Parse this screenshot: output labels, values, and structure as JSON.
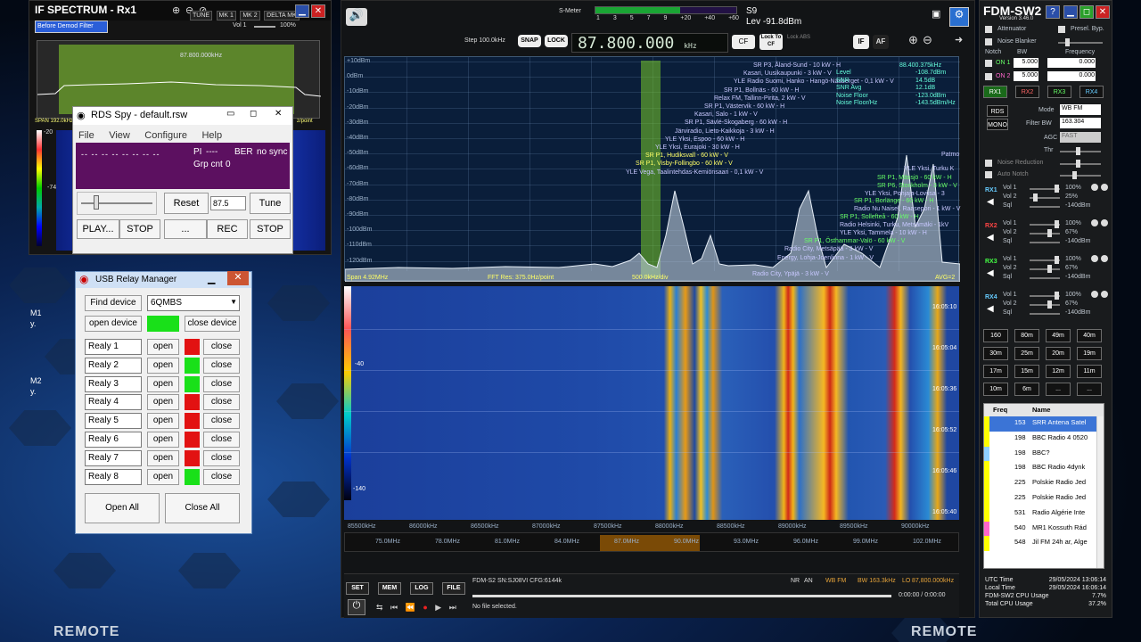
{
  "if_spectrum": {
    "title": "IF SPECTRUM - Rx1",
    "mode_select": "Before Demod Filter",
    "buttons": [
      "TUNE",
      "MK 1",
      "MK 2",
      "DELTA MK"
    ],
    "vol_label": "Vol 1",
    "vol_value": "100%",
    "axis": [
      "-100kHz",
      "-80kHz",
      "-60kHz",
      "-40kHz",
      "-20kHz",
      "0",
      "+20kHz",
      "+40kHz",
      "+60kHz",
      "+80kHz",
      "+100kHz"
    ],
    "freq_marker": "87.800.000kHz",
    "span": "SPAN 192.0kHz",
    "colorbar_top": "-20",
    "colorbar_low": "-74",
    "per_point": "z/point"
  },
  "rds_spy": {
    "title": "RDS Spy - default.rsw",
    "menu": [
      "File",
      "View",
      "Configure",
      "Help"
    ],
    "ps": "-- -- -- -- -- -- -- --",
    "pi_label": "PI",
    "pi_value": "----",
    "ber_label": "BER",
    "ber_value": "no sync",
    "grp_label": "Grp cnt",
    "grp_value": "0",
    "reset": "Reset",
    "freq": "87.5",
    "tune": "Tune",
    "play": "PLAY...",
    "stop1": "STOP",
    "dots": "...",
    "rec": "REC",
    "stop2": "STOP"
  },
  "usb_relay": {
    "title": "USB Relay Manager",
    "find_device": "Find device",
    "device": "6QMBS",
    "open_device": "open device",
    "close_device": "close device",
    "open": "open",
    "close": "close",
    "relays": [
      {
        "name": "Realy 1",
        "state": "red"
      },
      {
        "name": "Realy 2",
        "state": "green"
      },
      {
        "name": "Realy 3",
        "state": "green"
      },
      {
        "name": "Realy 4",
        "state": "red"
      },
      {
        "name": "Realy 5",
        "state": "red"
      },
      {
        "name": "Realy 6",
        "state": "red"
      },
      {
        "name": "Realy 7",
        "state": "red"
      },
      {
        "name": "Realy 8",
        "state": "green"
      }
    ],
    "open_all": "Open All",
    "close_all": "Close All"
  },
  "main": {
    "smeter_label": "S-Meter",
    "smeter_scale": [
      "1",
      "3",
      "5",
      "7",
      "9",
      "+20",
      "+40",
      "+60"
    ],
    "s_value": "S9",
    "level": "Lev -91.8dBm",
    "step": "Step 100.0kHz",
    "snap": "SNAP",
    "lock": "LOCK",
    "frequency": "87.800.000",
    "freq_unit": "kHz",
    "cf": "CF",
    "lock_to_cf": "Lock To CF",
    "lock_abs": "Lock ABS",
    "if_btn": "IF",
    "af_btn": "AF",
    "spec_db": [
      "+10dBm",
      "0dBm",
      "-10dBm",
      "-20dBm",
      "-30dBm",
      "-40dBm",
      "-50dBm",
      "-60dBm",
      "-70dBm",
      "-80dBm",
      "-90dBm",
      "-100dBm",
      "-110dBm",
      "-120dBm"
    ],
    "span": "Span 4.92MHz",
    "fft_res": "FFT Res: 375.0Hz/point",
    "div": "500.0kHz/div",
    "avg": "AVG=2",
    "wf_level_top": "-40",
    "wf_level_bottom": "-140",
    "freq_axis": [
      "85500kHz",
      "86000kHz",
      "86500kHz",
      "87000kHz",
      "87500kHz",
      "88000kHz",
      "88500kHz",
      "89000kHz",
      "89500kHz",
      "90000kHz"
    ],
    "band_axis": [
      "75.0MHz",
      "78.0MHz",
      "81.0MHz",
      "84.0MHz",
      "87.0MHz",
      "90.0MHz",
      "93.0MHz",
      "96.0MHz",
      "99.0MHz",
      "102.0MHz"
    ],
    "wf_times": [
      "16:05:10",
      "16:05:04",
      "16:05:36",
      "16:05:52",
      "16:05:46",
      "16:05:40"
    ],
    "stations": [
      {
        "t": "SR P3, Åland-Sund - 10 kW - H",
        "c": "#c8c8ff"
      },
      {
        "t": "Kasari, Uusikaupunki - 3 kW - V",
        "c": "#c8c8ff"
      },
      {
        "t": "YLE Radio Suomi, Hanko - Hangö-Näsberget - 0,1 kW - V",
        "c": "#c8c8ff"
      },
      {
        "t": "SR P1, Bollnäs - 60 kW - H",
        "c": "#c8c8ff"
      },
      {
        "t": "Relax FM, Tallinn-Pirita, 2 kW - V",
        "c": "#c8c8ff"
      },
      {
        "t": "SR P1, Västervik - 60 kW - H",
        "c": "#c8c8ff"
      },
      {
        "t": "Kasari, Salo - 1 kW - V",
        "c": "#c8c8ff"
      },
      {
        "t": "SR P1, Sävlé-Skogaberg - 60 kW - H",
        "c": "#c8c8ff"
      },
      {
        "t": "Järviradio, Lieto-Kaikkoja - 3 kW - H",
        "c": "#c8c8ff"
      },
      {
        "t": "YLE Yksi, Espoo - 60 kW - H",
        "c": "#c8c8ff"
      },
      {
        "t": "YLE Yksi, Eurajoki - 30 kW - H",
        "c": "#c8c8ff"
      },
      {
        "t": "SR P1, Hudiksvall - 60 kW - V",
        "c": "#ffff66"
      },
      {
        "t": "SR P1, Visby-Follingbo - 60 kW - V",
        "c": "#ffff66"
      },
      {
        "t": "YLE Vega, Taalintehdas-Kemiönsaari - 0,1 kW - V",
        "c": "#c8c8ff"
      }
    ],
    "stations_right": [
      {
        "t": "SR P1, Mässjö - 60 kW - H",
        "c": "#66ff66"
      },
      {
        "t": "SR P6, Stockholm - 3 kW - V",
        "c": "#66ff66"
      },
      {
        "t": "YLE Yksi, Pohjaja-Loviisa - 3",
        "c": "#c8c8ff"
      },
      {
        "t": "SR P1, Borlänge - 60 kW - H",
        "c": "#66ff66"
      },
      {
        "t": "Radio Nu Naisel, Raasepori - 1 kW - V",
        "c": "#c8c8ff"
      },
      {
        "t": "SR P1, Sollefteå - 60 kW - H",
        "c": "#66ff66"
      },
      {
        "t": "Radio Helsinki, Turku, Metsämäki - 1kV",
        "c": "#c8c8ff"
      },
      {
        "t": "YLE Yksi, Tammela - 10 kW - H",
        "c": "#c8c8ff"
      },
      {
        "t": "SR P1, Östhammar-Valö - 60 kW - V",
        "c": "#66ff66"
      },
      {
        "t": "Radio City, Metsäpää - 3 kW - V",
        "c": "#c8c8ff"
      },
      {
        "t": "Energy, Lohja-Joenlinna - 1 kW - V",
        "c": "#c8c8ff"
      },
      {
        "t": "Radio City, Ypäjä - 3 kW - V",
        "c": "#c8c8ff"
      },
      {
        "t": "YLE Yksi, Turku K",
        "c": "#c8c8ff"
      },
      {
        "t": "Patmo",
        "c": "#c8c8ff"
      }
    ],
    "readout": [
      {
        "k": "Level",
        "v": "-108.7dBm"
      },
      {
        "k": "SNR",
        "v": "14.5dB"
      },
      {
        "k": "SNR Avg",
        "v": "12.1dB"
      },
      {
        "k": "Noise Floor",
        "v": "-123.0dBm"
      },
      {
        "k": "Noise Floor/Hz",
        "v": "-143.5dBm/Hz"
      }
    ],
    "readout_freq": "88.400.375kHz",
    "set": "SET",
    "mem": "MEM",
    "log": "LOG",
    "file": "FILE",
    "device_info": "FDM-S2  SN:SJ08VI  CFG:6144k",
    "nr": "NR",
    "an": "AN",
    "mode": "WB FM",
    "bw": "BW 163.3kHz",
    "lo": "LO",
    "lo_freq": "87,800.000kHz",
    "time": "0:00:00 / 0:00:00",
    "no_file": "No file selected."
  },
  "right_panel": {
    "title": "FDM-SW2",
    "version": "Version 3.46.0",
    "attenuator": "Attenuator",
    "presel": "Presel. Byp.",
    "noise_blanker": "Noise Blanker",
    "notch": "Notch",
    "bw": "BW",
    "frequency": "Frequency",
    "on1": "ON 1",
    "on2": "ON 2",
    "bw1": "5.000",
    "bw2": "5.000",
    "f1": "0.000",
    "f2": "0.000",
    "rx": [
      "RX1",
      "RX2",
      "RX3",
      "RX4"
    ],
    "rds": "RDS",
    "mono": "MONO",
    "mode_label": "Mode",
    "mode_value": "WB FM",
    "filter_bw_label": "Filter BW",
    "filter_bw_value": "163.304",
    "agc_label": "AGC",
    "agc_value": "FAST",
    "thr_label": "Thr",
    "noise_reduction": "Noise Reduction",
    "auto_notch": "Auto Notch",
    "rx_groups": [
      {
        "name": "RX1",
        "vol1": "100%",
        "vol2": "25%",
        "sql": "-140dBm"
      },
      {
        "name": "RX2",
        "vol1": "100%",
        "vol2": "67%",
        "sql": "-140dBm"
      },
      {
        "name": "RX3",
        "vol1": "100%",
        "vol2": "67%",
        "sql": "-140dBm"
      },
      {
        "name": "RX4",
        "vol1": "100%",
        "vol2": "67%",
        "sql": "-140dBm"
      }
    ],
    "vol1": "Vol 1",
    "vol2": "Vol 2",
    "sql": "Sql",
    "bands": [
      "160",
      "80m",
      "49m",
      "40m",
      "30m",
      "25m",
      "20m",
      "19m",
      "17m",
      "15m",
      "12m",
      "11m",
      "10m",
      "6m",
      "...",
      "..."
    ],
    "list_header": [
      "Freq",
      "Name"
    ],
    "freq_list": [
      {
        "f": "153",
        "n": "SRR Antena Satel",
        "c": "#ffff00"
      },
      {
        "f": "198",
        "n": "BBC Radio 4 0520",
        "c": "#ffff00"
      },
      {
        "f": "198",
        "n": "BBC?",
        "c": "#8fd0ff"
      },
      {
        "f": "198",
        "n": "BBC Radio 4dynk",
        "c": "#ffff00"
      },
      {
        "f": "225",
        "n": "Polskie Radio Jed",
        "c": "#ffff00"
      },
      {
        "f": "225",
        "n": "Polskie Radio Jed",
        "c": "#ffff00"
      },
      {
        "f": "531",
        "n": "Radio Algérie Inte",
        "c": "#ffff00"
      },
      {
        "f": "540",
        "n": "MR1 Kossuth Rád",
        "c": "#ff66cc"
      },
      {
        "f": "548",
        "n": "Jil FM 24h ar, Alge",
        "c": "#ffff00"
      }
    ],
    "stats": [
      {
        "k": "UTC Time",
        "v": "29/05/2024 13:06:14"
      },
      {
        "k": "Local Time",
        "v": "29/05/2024 16:06:14"
      },
      {
        "k": "FDM-SW2 CPU Usage",
        "v": "7.7%"
      },
      {
        "k": "Total CPU Usage",
        "v": "37.2%"
      }
    ]
  },
  "desktop": {
    "remote_left": "REMOTE",
    "remote_right": "REMOTE",
    "side_labels": [
      "M1",
      "y.",
      "M2",
      "y."
    ]
  }
}
